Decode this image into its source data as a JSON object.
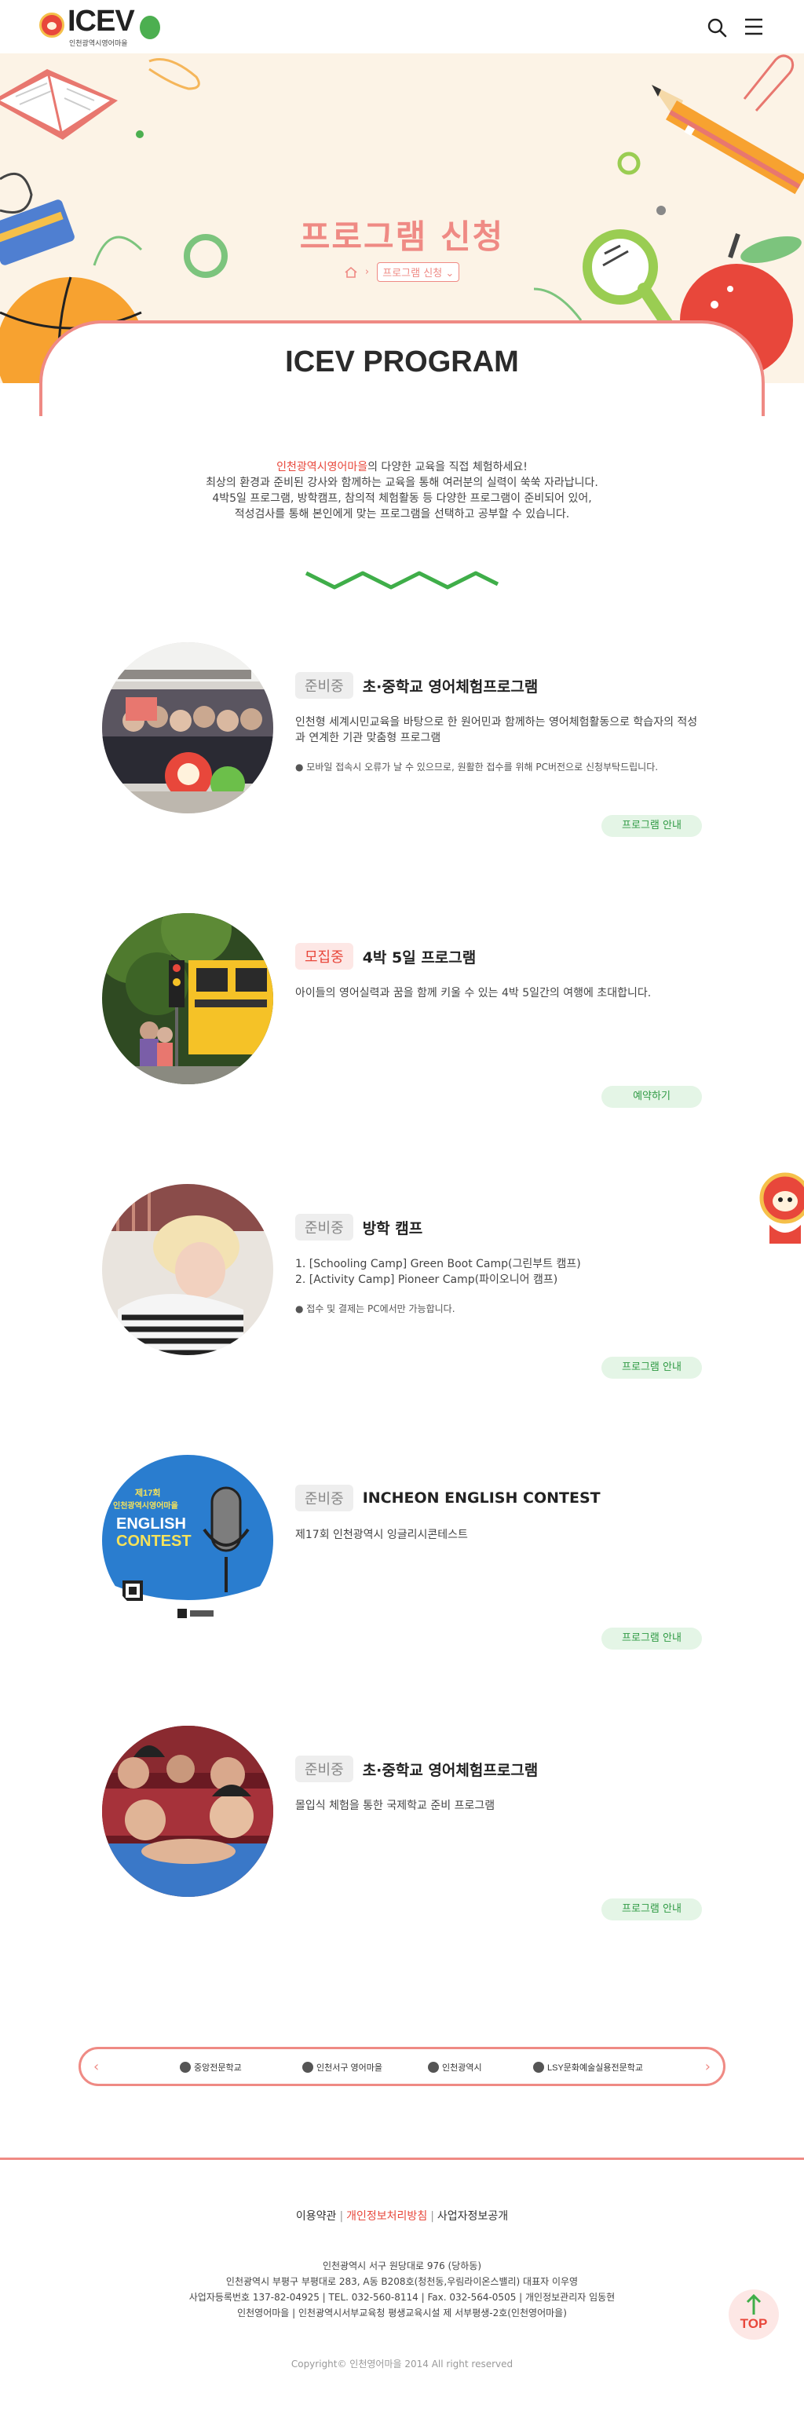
{
  "brand": {
    "logo_text": "ICEV",
    "logo_subtitle": "인천광역시영어마을"
  },
  "hero": {
    "title": "프로그램 신청",
    "breadcrumb_current": "프로그램 신청",
    "breadcrumb_caret": "⌄"
  },
  "section": {
    "heading": "ICEV PROGRAM",
    "intro_highlight": "인천광역시영어마을",
    "intro_line1_rest": "의 다양한 교육을 직접 체험하세요!",
    "intro_line2": "최상의 환경과 준비된 강사와 함께하는 교육을 통해 여러분의 실력이 쑥쑥 자라납니다.",
    "intro_line3": "4박5일 프로그램, 방학캠프, 참의적 체험활동 등 다양한 프로그램이 준비되어 있어,",
    "intro_line4": "적성검사를 통해 본인에게 맞는 프로그램을 선택하고 공부할 수 있습니다."
  },
  "programs": [
    {
      "status": "준비중",
      "title": "초·중학교 영어체험프로그램",
      "desc": "인천형 세계시민교육을 바탕으로 한 원어민과 함께하는 영어체험활동으로 학습자의 적성과 연계한 기관 맞춤형 프로그램",
      "note": "● 모바일 접속시 오류가 날 수 있으므로, 원활한 접수를 위해 PC버전으로 신청부탁드립니다.",
      "button": "프로그램 안내"
    },
    {
      "status": "모집중",
      "title": "4박 5일 프로그램",
      "desc": "아이들의 영어실력과 꿈을 함께 키울 수 있는 4박 5일간의 여행에 초대합니다.",
      "note": "",
      "button": "예약하기"
    },
    {
      "status": "준비중",
      "title": "방학 캠프",
      "desc_line1": "1. [Schooling Camp] Green Boot Camp(그린부트 캠프)",
      "desc_line2": "2. [Activity Camp] Pioneer Camp(파이오니어 캠프)",
      "note": "● 접수 및 결제는 PC에서만 가능합니다.",
      "button": "프로그램 안내"
    },
    {
      "status": "준비중",
      "title": "INCHEON ENGLISH CONTEST",
      "desc": "제17회 인천광역시 잉글리시콘테스트",
      "note": "",
      "button": "프로그램 안내",
      "poster_line1": "제17회",
      "poster_line2": "인천광역시영어마을",
      "poster_line3": "ENGLISH",
      "poster_line4": "CONTEST"
    },
    {
      "status": "준비중",
      "title": "초·중학교 영어체험프로그램",
      "desc": "몰입식 체험을 통한 국제학교 준비 프로그램",
      "note": "",
      "button": "프로그램 안내"
    }
  ],
  "partners": {
    "prev": "‹",
    "next": "›",
    "logos": [
      "중앙전문학교",
      "인천서구 영어마을",
      "인천광역시",
      "LSY문화예술실용전문학교"
    ]
  },
  "footer": {
    "link1": "이용약관",
    "link2": "개인정보처리방침",
    "link3": "사업자정보공개",
    "info1": "인천광역시 서구 원당대로 976 (당하동)",
    "info2": "인천광역시 부평구 부평대로 283, A동 B208호(청천동,우림라이온스밸리) 대표자 이우영",
    "info3": "사업자등록번호 137-82-04925 | TEL. 032-560-8114 | Fax. 032-564-0505 | 개인정보관리자 임동현",
    "info4": "인천영어마을 | 인천광역시서부교육청 평생교육시설 제 서부평생-2호(인천영어마을)",
    "copyright": "Copyright© 인천영어마을 2014 All right reserved",
    "top_label": "TOP"
  },
  "colors": {
    "accent": "#ef8a84",
    "accent_dark": "#e8473b",
    "green": "#2f9a44",
    "hero_bg": "#fcf3e6"
  }
}
